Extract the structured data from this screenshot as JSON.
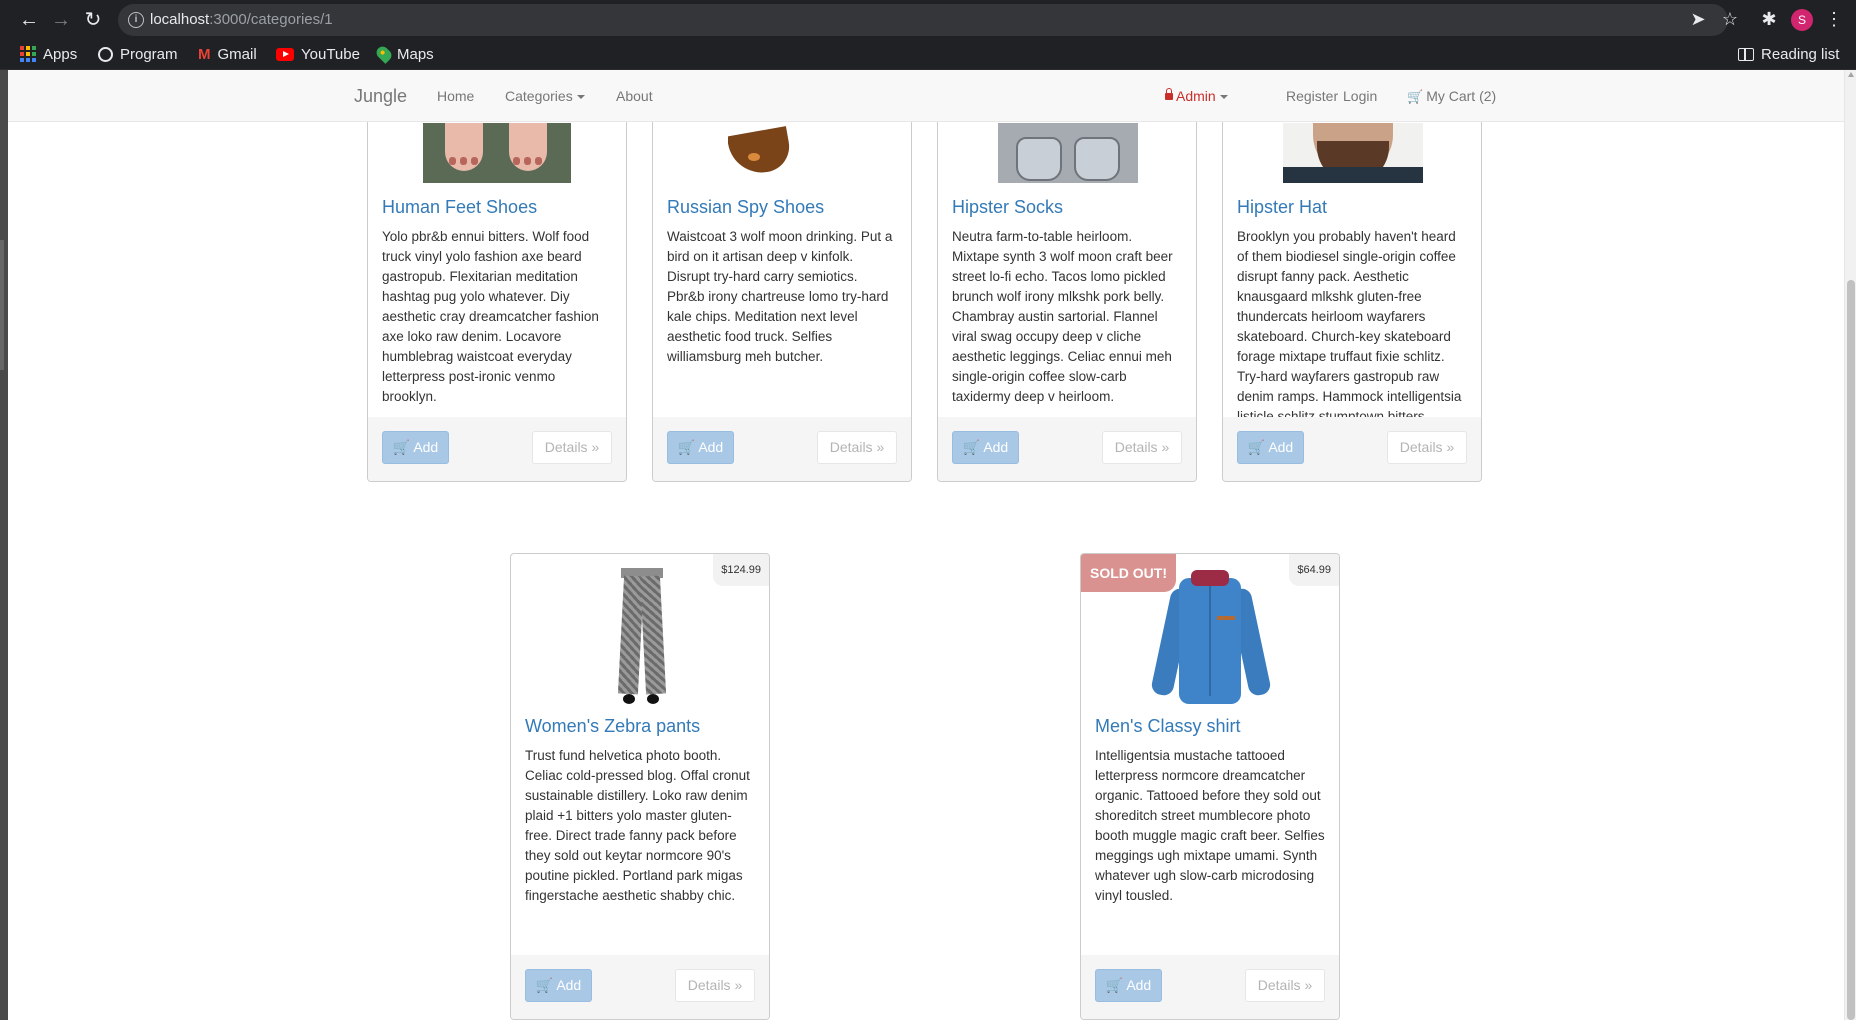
{
  "browser": {
    "url_host": "localhost",
    "url_rest": ":3000/categories/1",
    "profile_initial": "S",
    "bookmarks": [
      {
        "label": "Apps",
        "icon": "apps-grid-icon"
      },
      {
        "label": "Program",
        "icon": "globe-icon"
      },
      {
        "label": "Gmail",
        "icon": "gmail-icon"
      },
      {
        "label": "YouTube",
        "icon": "youtube-icon"
      },
      {
        "label": "Maps",
        "icon": "maps-icon"
      }
    ],
    "reading_list": "Reading list"
  },
  "navbar": {
    "brand": "Jungle",
    "home": "Home",
    "categories": "Categories",
    "about": "About",
    "admin": "Admin",
    "register": "Register",
    "login": "Login",
    "cart": "My Cart (2)"
  },
  "products": [
    {
      "name": "Human Feet Shoes",
      "description": "Yolo pbr&b ennui bitters. Wolf food truck vinyl yolo fashion axe beard gastropub. Flexitarian meditation hashtag pug yolo whatever. Diy aesthetic cray dreamcatcher fashion axe loko raw denim. Locavore humblebrag waistcoat everyday letterpress post-ironic venmo brooklyn.",
      "add_label": "Add",
      "details_label": "Details »"
    },
    {
      "name": "Russian Spy Shoes",
      "description": "Waistcoat 3 wolf moon drinking. Put a bird on it artisan deep v kinfolk. Disrupt try-hard carry semiotics. Pbr&b irony chartreuse lomo try-hard kale chips. Meditation next level aesthetic food truck. Selfies williamsburg meh butcher.",
      "add_label": "Add",
      "details_label": "Details »"
    },
    {
      "name": "Hipster Socks",
      "description": "Neutra farm-to-table heirloom. Mixtape synth 3 wolf moon craft beer street lo-fi echo. Tacos lomo pickled brunch wolf irony mlkshk pork belly. Chambray austin sartorial. Flannel viral swag occupy deep v cliche aesthetic leggings. Celiac ennui meh single-origin coffee slow-carb taxidermy deep v heirloom.",
      "add_label": "Add",
      "details_label": "Details »"
    },
    {
      "name": "Hipster Hat",
      "description": "Brooklyn you probably haven't heard of them biodiesel single-origin coffee disrupt fanny pack. Aesthetic knausgaard mlkshk gluten-free thundercats heirloom wayfarers skateboard. Church-key skateboard forage mixtape truffaut fixie schlitz. Try-hard wayfarers gastropub raw denim ramps. Hammock intelligentsia listicle schlitz stumptown bitters.",
      "add_label": "Add",
      "details_label": "Details »"
    },
    {
      "name": "Women's Zebra pants",
      "price": "$124.99",
      "description": "Trust fund helvetica photo booth. Celiac cold-pressed blog. Offal cronut sustainable distillery. Loko raw denim plaid +1 bitters yolo master gluten-free. Direct trade fanny pack before they sold out keytar normcore 90's poutine pickled. Portland park migas fingerstache aesthetic shabby chic.",
      "add_label": "Add",
      "details_label": "Details »"
    },
    {
      "name": "Men's Classy shirt",
      "price": "$64.99",
      "badge": "SOLD OUT!",
      "description": "Intelligentsia mustache tattooed letterpress normcore dreamcatcher organic. Tattooed before they sold out shoreditch street mumblecore photo booth muggle magic craft beer. Selfies meggings ugh mixtape umami. Synth whatever ugh slow-carb microdosing vinyl tousled.",
      "add_label": "Add",
      "details_label": "Details »"
    }
  ]
}
